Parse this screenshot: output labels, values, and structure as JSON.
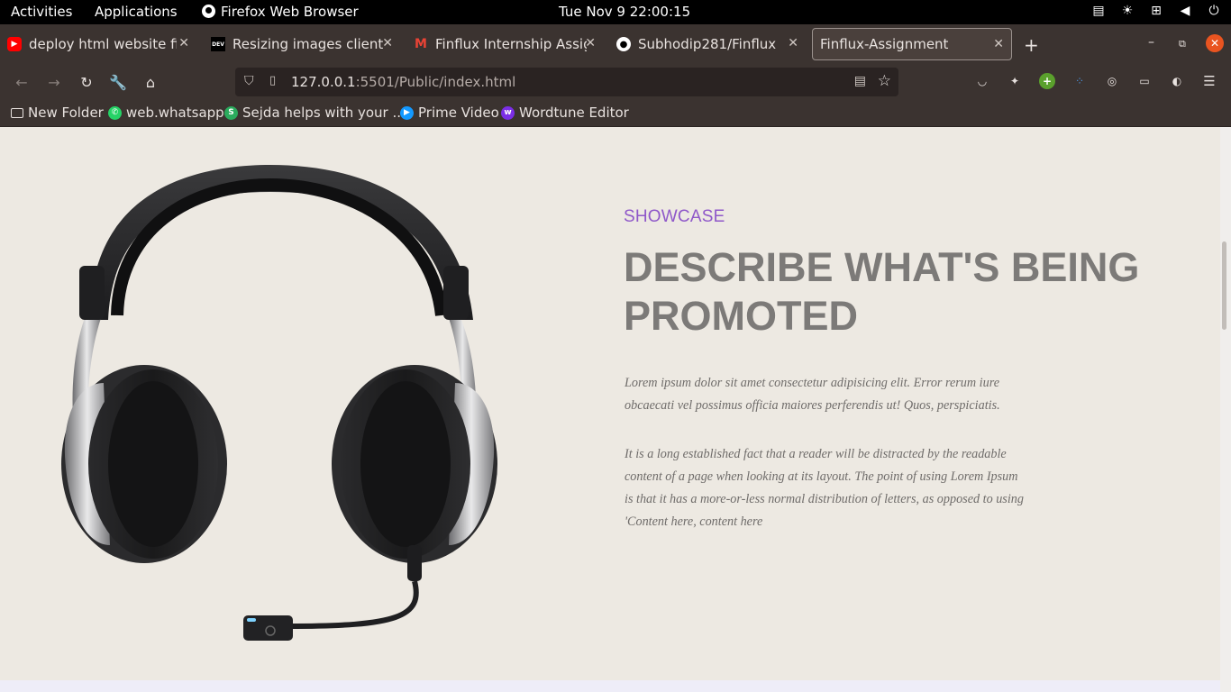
{
  "system_bar": {
    "activities": "Activities",
    "applications": "Applications",
    "app_name": "Firefox Web Browser",
    "clock": "Tue Nov 9  22:00:15"
  },
  "tabs": [
    {
      "title": "deploy html website fireb",
      "favicon": "youtube-icon",
      "color": "#ff0000"
    },
    {
      "title": "Resizing images client-sid",
      "favicon": "dev-icon",
      "color": "#000000"
    },
    {
      "title": "Finflux Internship Assignm",
      "favicon": "gmail-icon",
      "color": "#ea4335"
    },
    {
      "title": "Subhodip281/Finflux",
      "favicon": "github-icon",
      "color": "#ffffff"
    },
    {
      "title": "Finflux-Assignment",
      "favicon": "",
      "color": ""
    }
  ],
  "url": {
    "host": "127.0.0.1",
    "rest": ":5501/Public/index.html"
  },
  "bookmarks": [
    {
      "label": "New Folder",
      "icon": "folder-icon"
    },
    {
      "label": "web.whatsapp",
      "icon": "whatsapp-icon"
    },
    {
      "label": "Sejda helps with your ...",
      "icon": "sejda-icon"
    },
    {
      "label": "Prime Video",
      "icon": "prime-video-icon"
    },
    {
      "label": "Wordtune Editor",
      "icon": "wordtune-icon"
    }
  ],
  "page": {
    "eyebrow": "SHOWCASE",
    "headline": "DESCRIBE WHAT'S BEING PROMOTED",
    "paragraph1": "Lorem ipsum dolor sit amet consectetur adipisicing elit. Error rerum iure obcaecati vel possimus officia maiores perferendis ut! Quos, perspiciatis.",
    "paragraph2": "It is a long established fact that a reader will be distracted by the readable content of a page when looking at its layout. The point of using Lorem Ipsum is that it has a more-or-less normal distribution of letters, as opposed to using 'Content here, content here"
  },
  "colors": {
    "accent": "#8f58c9",
    "page_bg": "#ede9e2",
    "heading": "#7c7a78"
  }
}
